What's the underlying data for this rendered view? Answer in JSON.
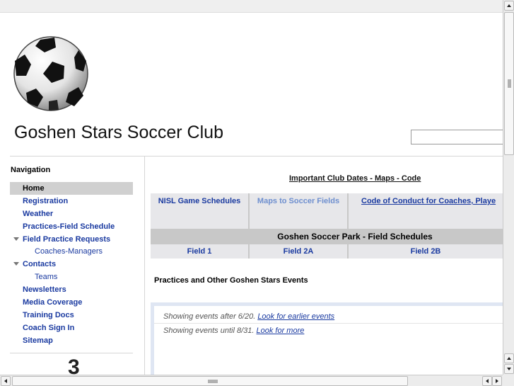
{
  "site": {
    "title": "Goshen Stars Soccer Club"
  },
  "search": {
    "value": "",
    "placeholder": ""
  },
  "nav": {
    "heading": "Navigation",
    "items": [
      {
        "label": "Home",
        "active": true
      },
      {
        "label": "Registration"
      },
      {
        "label": "Weather"
      },
      {
        "label": "Practices-Field Schedule"
      },
      {
        "label": "Field Practice Requests",
        "expanded": true
      },
      {
        "label": "Coaches-Managers",
        "sub": true
      },
      {
        "label": "Contacts",
        "expanded": true
      },
      {
        "label": "Teams",
        "sub": true
      },
      {
        "label": "Newsletters"
      },
      {
        "label": "Media Coverage"
      },
      {
        "label": "Training Docs"
      },
      {
        "label": "Coach Sign In"
      },
      {
        "label": "Sitemap"
      }
    ],
    "widget_text": "3"
  },
  "content": {
    "important_link": "Important Club Dates - Maps - Code",
    "table": {
      "row1": [
        "NISL Game Schedules",
        "Maps to Soccer Fields",
        "Code of Conduct for Coaches, Playe"
      ],
      "park": "Goshen Soccer Park - Field Schedules",
      "fields": [
        "Field 1",
        "Field 2A",
        "Field 2B"
      ]
    },
    "events_heading": "Practices and Other Goshen Stars Events",
    "calendar": {
      "line1_text": "Showing events after 6/20. ",
      "line1_link": "Look for earlier events",
      "line2_text": "Showing events until 8/31. ",
      "line2_link": "Look for more"
    }
  },
  "colors": {
    "link": "#1a3aa0",
    "muted_link": "#6e8fcf",
    "active_bg": "#d0d0d0",
    "table_bg": "#e7e7ea"
  }
}
